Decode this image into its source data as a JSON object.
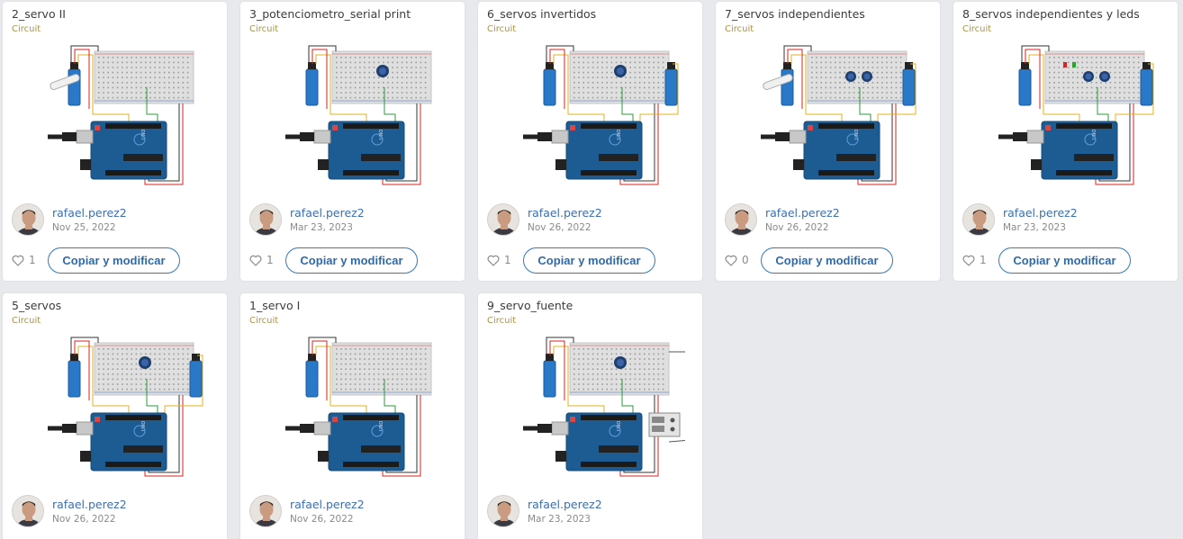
{
  "cards": [
    {
      "title": "2_servo II",
      "type": "Circuit",
      "author": "rafael.perez2",
      "date": "Nov 25, 2022",
      "likes": "1",
      "button": "Copiar y modificar",
      "variant": "servo2"
    },
    {
      "title": "3_potenciometro_serial print",
      "type": "Circuit",
      "author": "rafael.perez2",
      "date": "Mar 23, 2023",
      "likes": "1",
      "button": "Copiar y modificar",
      "variant": "pot"
    },
    {
      "title": "6_servos invertidos",
      "type": "Circuit",
      "author": "rafael.perez2",
      "date": "Nov 26, 2022",
      "likes": "1",
      "button": "Copiar y modificar",
      "variant": "two_servos_pot"
    },
    {
      "title": "7_servos independientes",
      "type": "Circuit",
      "author": "rafael.perez2",
      "date": "Nov 26, 2022",
      "likes": "0",
      "button": "Copiar y modificar",
      "variant": "two_servos_two_pots"
    },
    {
      "title": "8_servos independientes y leds",
      "type": "Circuit",
      "author": "rafael.perez2",
      "date": "Mar 23, 2023",
      "likes": "1",
      "button": "Copiar y modificar",
      "variant": "leds"
    },
    {
      "title": "5_servos",
      "type": "Circuit",
      "author": "rafael.perez2",
      "date": "Nov 26, 2022",
      "variant": "two_servos_pot"
    },
    {
      "title": "1_servo I",
      "type": "Circuit",
      "author": "rafael.perez2",
      "date": "Nov 26, 2022",
      "variant": "servo1"
    },
    {
      "title": "9_servo_fuente",
      "type": "Circuit",
      "author": "rafael.perez2",
      "date": "Mar 23, 2023",
      "variant": "fuente"
    }
  ],
  "icons": {
    "like": "heart-outline-icon"
  },
  "colors": {
    "accent": "#2f7bc0",
    "author": "#3b6fb0",
    "type_label": "#a8934a",
    "background": "#e8e9ec"
  }
}
